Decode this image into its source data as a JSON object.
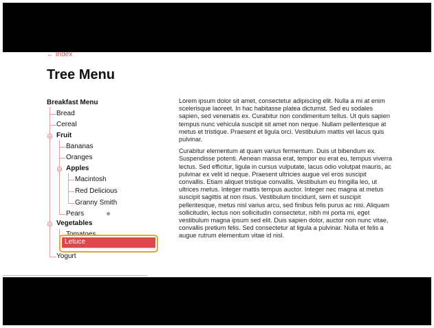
{
  "nav": {
    "back_label": "← Index"
  },
  "page": {
    "title": "Tree Menu"
  },
  "tree": {
    "root": "Breakfast Menu",
    "items": {
      "bread": "Bread",
      "cereal": "Cereal",
      "fruit": "Fruit",
      "bananas": "Bananas",
      "oranges": "Oranges",
      "apples": "Apples",
      "macintosh": "Macintosh",
      "red_delicious": "Red Delicious",
      "granny_smith": "Granny Smith",
      "pears": "Pears",
      "vegetables": "Vegetables",
      "tomatoes": "Tomatoes",
      "lettuce": "Letuce",
      "yogurt": "Yogurt"
    },
    "selected": "Letuce",
    "colors": {
      "accent": "#e0474c",
      "focus": "#f0a033",
      "branch": "#e89a9c"
    }
  },
  "article": {
    "p1": "Lorem ipsum dolor sit amet, consectetur adipiscing elit. Nulla a mi at enim scelerisque laoreet. In hac habitasse platea dictumst. Sed eu sodales sapien, sed venenatis ex. Curabitur non condimentum tellus. Ut quis sapien tempus nunc vehicula suscipit sit amet non neque. Nullam pellentesque at metus et tristique. Praesent et ligula orci. Vestibulum mattis vel lacus quis pulvinar.",
    "p2": "Curabitur elementum at quam varius fermentum. Duis ut bibendum ex. Suspendisse potenti. Aenean massa erat, tempor eu erat eu, tempus viverra lectus. Sed efficitur, ligula in cursus vulputate, lacus odio volutpat mauris, ac pulvinar ex velit id neque. Praesent ultricies augue vel eros suscipit convallis. Etiam aliquet tristique convallis. Vestibulum eu fringilla leo, ut ultrices metus. Integer mattis tempus auctor. Integer nec magna at metus suscipit sagittis at non risus. Vestibulum tincidunt, sem et suscipit pellentesque, metus nisl varius arcu, sed finibus felis purus ac nisi. Aliquam sollicitudin, lectus non sollicitudin consectetur, nibh mi porta mi, eget vestibulum magna ipsum sed elit. Duis sapien dolor, auctor non nunc vitae, convallis pretium felis. Sed consectetur at ligula a pulvinar. Nulla et felis a augue rutrum elementum vitae id nisl."
  }
}
